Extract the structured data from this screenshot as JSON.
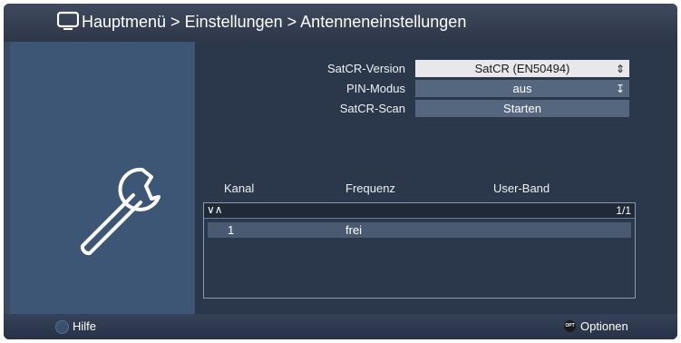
{
  "header": {
    "breadcrumb": "Hauptmenü > Einstellungen > Antenneneinstellungen"
  },
  "settings": [
    {
      "label": "SatCR-Version",
      "value": "SatCR (EN50494)",
      "selected": true,
      "arrow": "⇕"
    },
    {
      "label": "PIN-Modus",
      "value": "aus",
      "selected": false,
      "arrow": "↧"
    },
    {
      "label": "SatCR-Scan",
      "value": "Starten",
      "selected": false,
      "arrow": ""
    }
  ],
  "table": {
    "columns": [
      "Kanal",
      "Frequenz",
      "User-Band"
    ],
    "scroll_indicator": "∨∧",
    "page": "1/1",
    "rows": [
      {
        "kanal": "1",
        "frequenz": "frei",
        "user_band": ""
      }
    ]
  },
  "footer": {
    "help_label": "Hilfe",
    "opt_badge": "OPT",
    "options_label": "Optionen"
  }
}
